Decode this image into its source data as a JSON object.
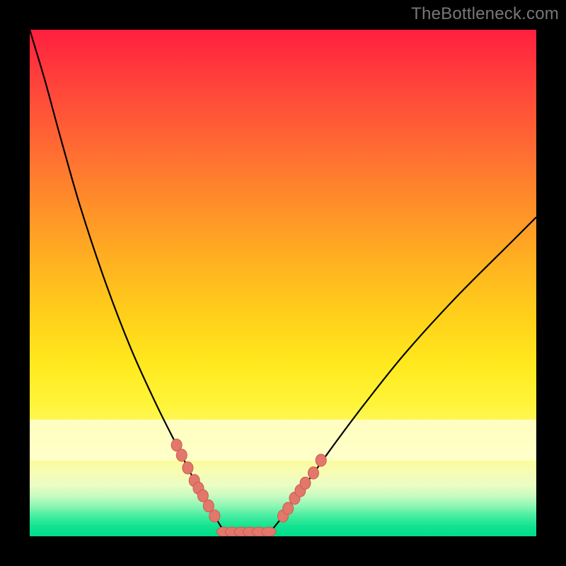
{
  "watermark": "TheBottleneck.com",
  "colors": {
    "frame": "#000000",
    "curve": "#000000",
    "marker_fill": "#e2776b",
    "marker_stroke": "#cf5a50",
    "flat_marker_fill": "#e2776b"
  },
  "chart_data": {
    "type": "line",
    "title": "",
    "xlabel": "",
    "ylabel": "",
    "xlim": [
      0,
      100
    ],
    "ylim": [
      0,
      100
    ],
    "left_curve": {
      "x": [
        0,
        3,
        6,
        10,
        15,
        20,
        25,
        29,
        32,
        34.5,
        36.5,
        38
      ],
      "y": [
        100,
        90,
        79,
        65,
        50,
        37,
        26,
        18,
        12,
        7.5,
        4,
        1.5
      ]
    },
    "right_curve": {
      "x": [
        48,
        50,
        52,
        55,
        60,
        66,
        74,
        84,
        95,
        100
      ],
      "y": [
        1.5,
        4,
        7,
        11,
        18,
        26,
        36,
        47,
        58,
        63
      ]
    },
    "flat_segment": {
      "x": [
        38,
        48
      ],
      "y": 0.9
    },
    "series": [
      {
        "name": "left-branch-markers",
        "x": [
          29.0,
          30.0,
          31.2,
          32.5,
          33.3,
          34.2,
          35.3,
          36.5
        ],
        "y": [
          18.0,
          16.0,
          13.5,
          11.0,
          9.5,
          8.0,
          6.0,
          4.0
        ]
      },
      {
        "name": "right-branch-markers",
        "x": [
          50.0,
          51.0,
          52.3,
          53.4,
          54.4,
          56.0,
          57.5
        ],
        "y": [
          4.0,
          5.5,
          7.5,
          9.0,
          10.5,
          12.5,
          15.0
        ]
      },
      {
        "name": "flat-markers",
        "x": [
          38.3,
          40.0,
          41.8,
          43.5,
          45.3,
          47.2
        ],
        "y": [
          0.9,
          0.9,
          0.9,
          0.9,
          0.9,
          0.9
        ]
      }
    ]
  }
}
